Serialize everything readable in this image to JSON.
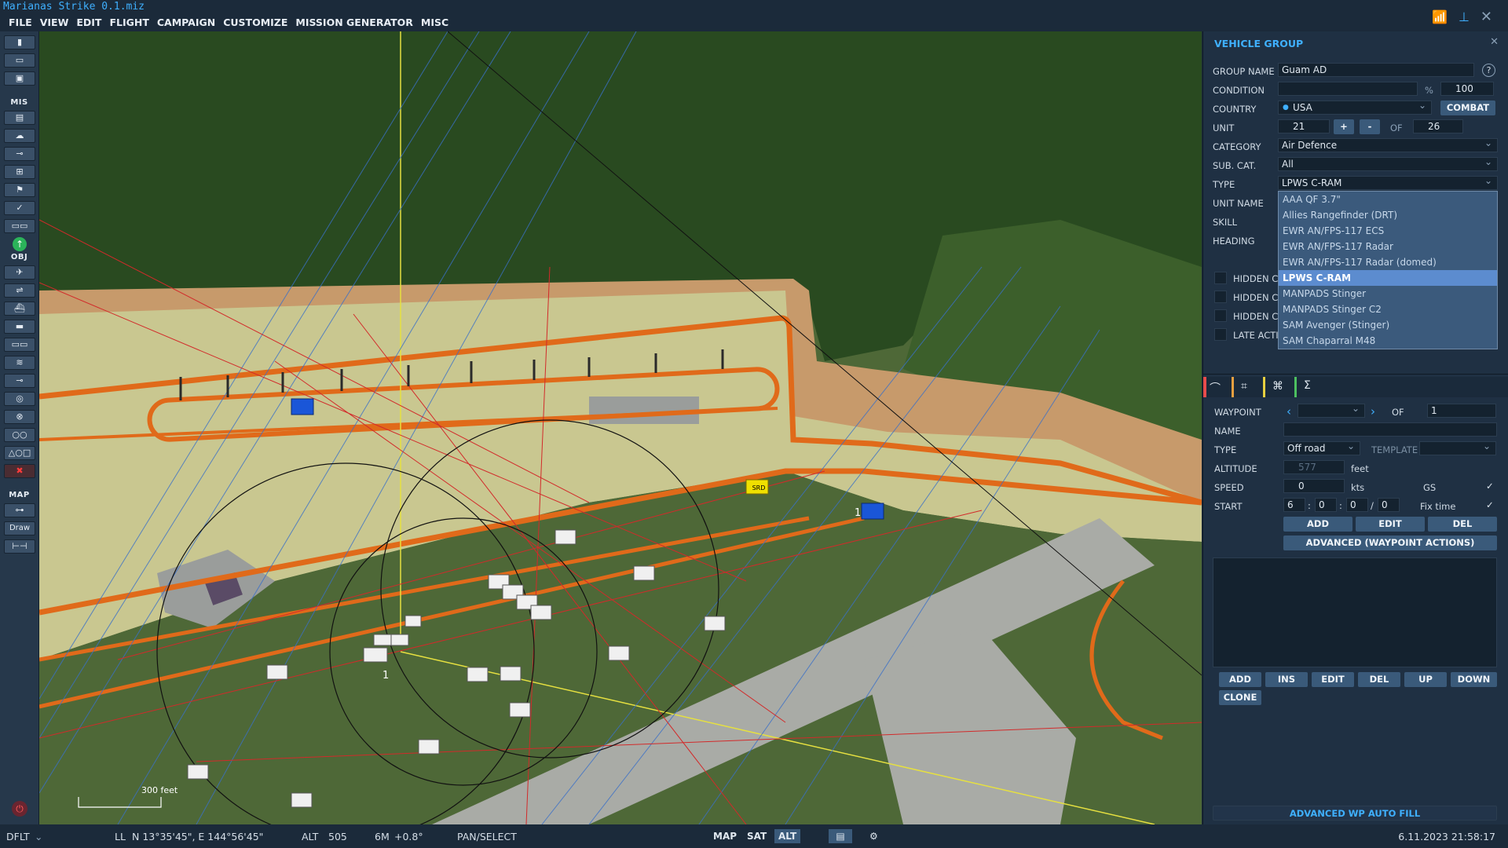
{
  "window": {
    "title": "Marianas Strike 0.1.miz"
  },
  "menu": [
    "FILE",
    "VIEW",
    "EDIT",
    "FLIGHT",
    "CAMPAIGN",
    "CUSTOMIZE",
    "MISSION GENERATOR",
    "MISC"
  ],
  "toolbar": {
    "sections": {
      "mis": "MIS",
      "obj": "OBJ",
      "map": "MAP"
    },
    "draw": "Draw"
  },
  "panel": {
    "title": "VEHICLE GROUP",
    "group_name_label": "GROUP NAME",
    "group_name": "Guam AD",
    "help": "?",
    "condition_label": "CONDITION",
    "condition_pct": "%",
    "condition": "100",
    "country_label": "COUNTRY",
    "country": "USA",
    "combat": "COMBAT",
    "unit_label": "UNIT",
    "unit": "21",
    "plus": "+",
    "minus": "-",
    "of": "OF",
    "unit_total": "26",
    "category_label": "CATEGORY",
    "category": "Air Defence",
    "subcat_label": "SUB. CAT.",
    "subcat": "All",
    "type_label": "TYPE",
    "type": "LPWS C-RAM",
    "unit_name_label": "UNIT NAME",
    "skill_label": "SKILL",
    "heading_label": "HEADING",
    "type_options": [
      "AAA QF 3.7\"",
      "Allies Rangefinder (DRT)",
      "EWR AN/FPS-117 ECS",
      "EWR AN/FPS-117 Radar",
      "EWR AN/FPS-117 Radar (domed)",
      "LPWS C-RAM",
      "MANPADS Stinger",
      "MANPADS Stinger C2",
      "SAM Avenger (Stinger)",
      "SAM Chaparral M48"
    ],
    "type_selected_index": 5,
    "checks": [
      "HIDDEN C",
      "HIDDEN C",
      "HIDDEN C",
      "LATE ACTI"
    ],
    "waypoint_label": "WAYPOINT",
    "wp_of": "1",
    "name_label": "NAME",
    "wptype_label": "TYPE",
    "wptype": "Off road",
    "template_label": "TEMPLATE",
    "altitude_label": "ALTITUDE",
    "altitude": "577",
    "feet": "feet",
    "speed_label": "SPEED",
    "speed": "0",
    "kts": "kts",
    "gs": "GS",
    "start_label": "START",
    "start_d": "6",
    "start_h": "0",
    "start_m": "0",
    "start_s": "0",
    "fix_time": "Fix time",
    "add": "ADD",
    "edit": "EDIT",
    "del": "DEL",
    "advanced": "ADVANCED (WAYPOINT ACTIONS)",
    "actions": [
      "ADD",
      "INS",
      "EDIT",
      "DEL",
      "UP",
      "DOWN"
    ],
    "clone": "CLONE",
    "autofill": "ADVANCED WP AUTO FILL"
  },
  "map": {
    "scale_label": "300 feet",
    "unit_num_a": "1",
    "unit_num_b": "1",
    "srd": "SRD"
  },
  "status": {
    "profile": "DFLT",
    "ll": "LL",
    "coords": "N 13°35'45\", E 144°56'45\"",
    "alt_label": "ALT",
    "alt": "505",
    "mag": "6M",
    "decl": "+0.8°",
    "mode": "PAN/SELECT",
    "map": "MAP",
    "sat": "SAT",
    "alt_btn": "ALT",
    "datetime": "6.11.2023 21:58:17"
  },
  "colors": {
    "accent": "#3fb0ff",
    "route": "#e06a1a",
    "bg": "#1b2a3a"
  }
}
